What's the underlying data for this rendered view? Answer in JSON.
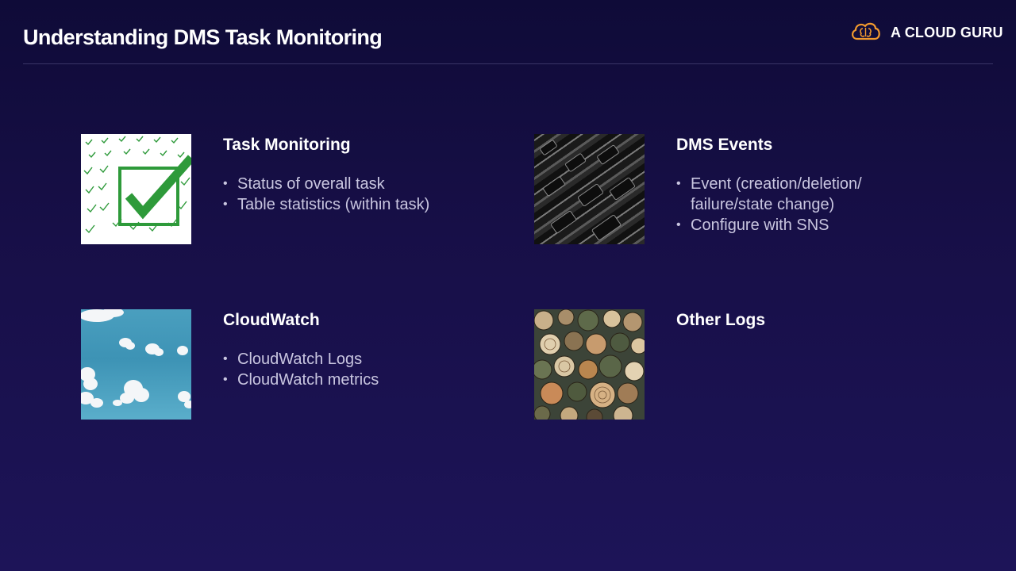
{
  "slide": {
    "title": "Understanding DMS Task Monitoring"
  },
  "brand": {
    "name": "A CLOUD GURU",
    "icon": "cloud-brain-icon",
    "accent_color": "#f29a2e"
  },
  "cards": [
    {
      "title": "Task Monitoring",
      "image": "checkmark-pattern-image",
      "bullets": [
        "Status of overall task",
        "Table statistics (within task)"
      ]
    },
    {
      "title": "DMS Events",
      "image": "server-rack-image",
      "bullets": [
        [
          "Event (creation/deletion/",
          "failure/state change)"
        ],
        "Configure with SNS"
      ]
    },
    {
      "title": "CloudWatch",
      "image": "sky-clouds-image",
      "bullets": [
        "CloudWatch Logs",
        "CloudWatch metrics"
      ]
    },
    {
      "title": "Other Logs",
      "image": "wood-logs-image",
      "bullets": []
    }
  ]
}
